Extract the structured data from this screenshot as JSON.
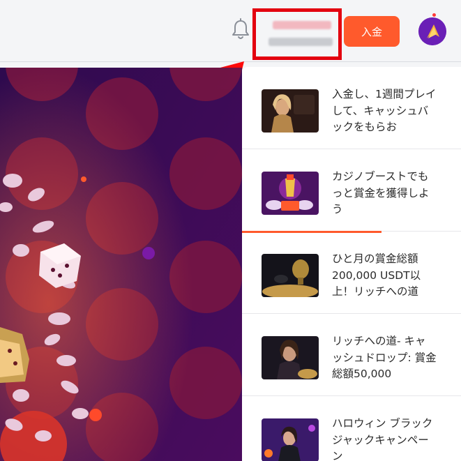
{
  "header": {
    "deposit_label": "入金"
  },
  "promotions": [
    {
      "title": "入金し、1週間プレイして、キャッシュバックをもらお"
    },
    {
      "title": "カジノブーストでもっと賞金を獲得しよう"
    },
    {
      "title": "ひと月の賞金総額200,000 USDT以上！リッチへの道"
    },
    {
      "title": "リッチへの道- キャッシュドロップ: 賞金総額50,000"
    },
    {
      "title": "ハロウィン ブラックジャックキャンペーン"
    }
  ],
  "colors": {
    "accent": "#ff5a2c",
    "highlight_box": "#e3000f",
    "banner_bg": "#3a0a5a"
  },
  "icons": {
    "bell": "bell-icon",
    "arrow": "annotation-arrow-icon",
    "avatar": "user-avatar-icon"
  }
}
